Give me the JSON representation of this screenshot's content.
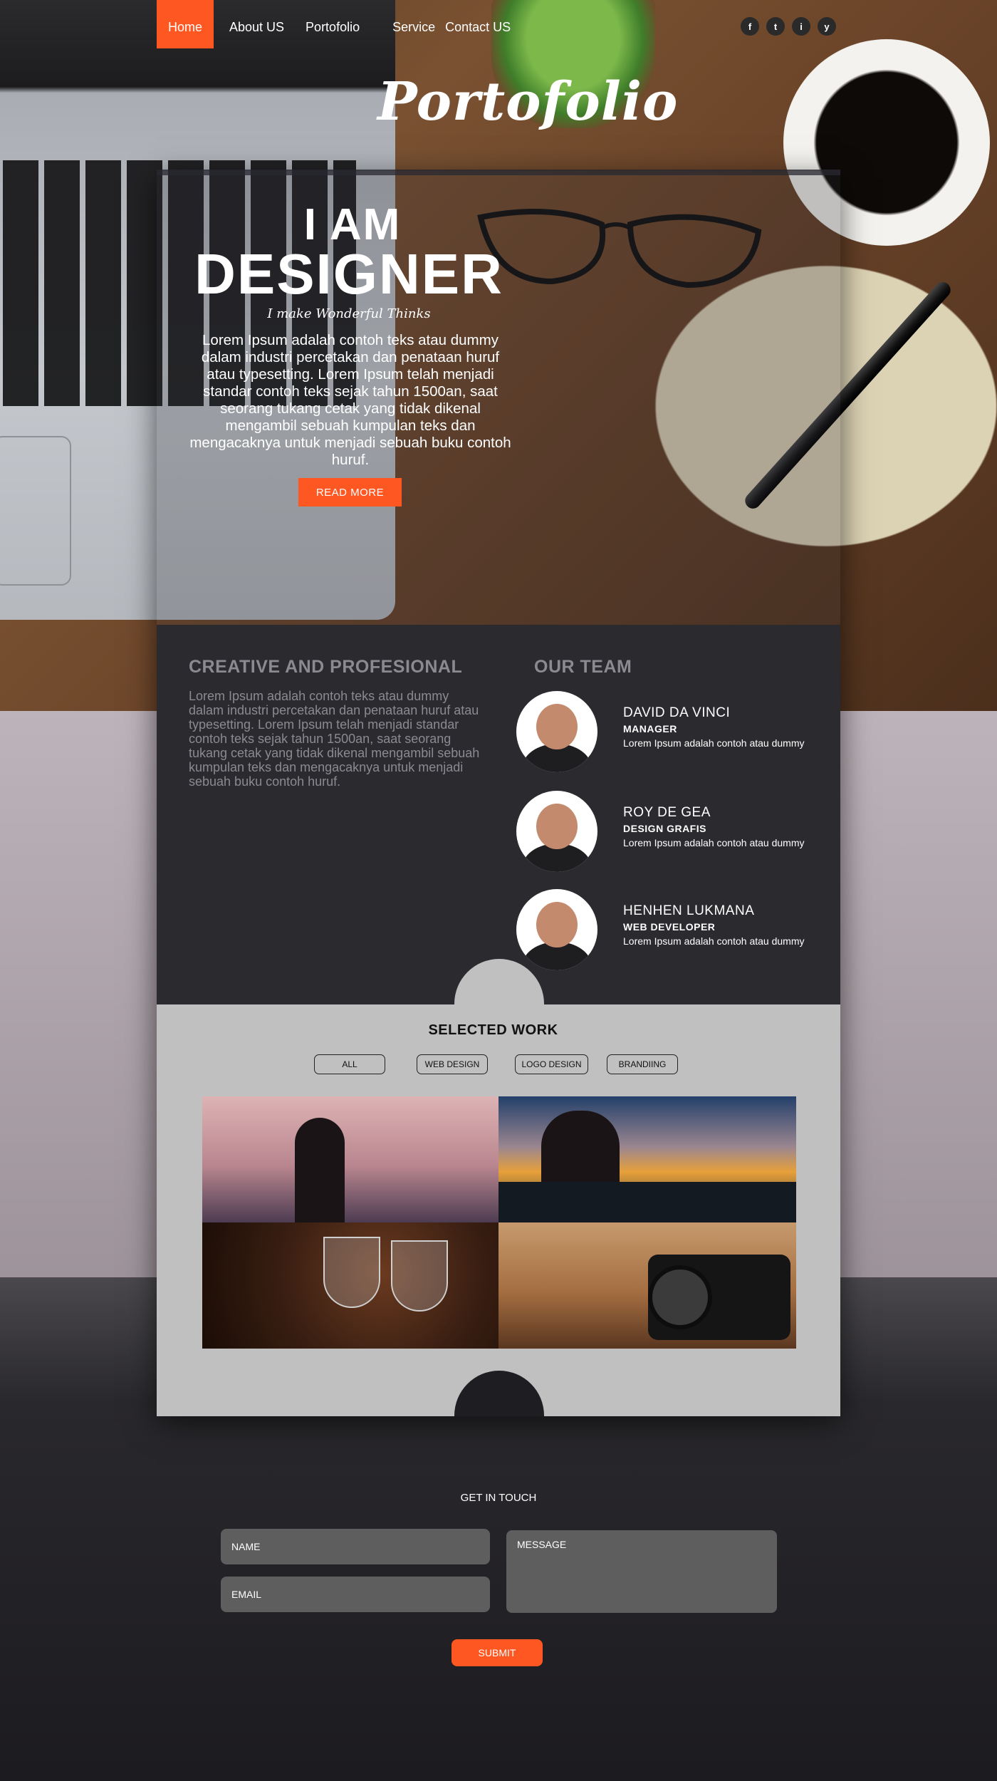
{
  "nav": {
    "items": [
      "Home",
      "About US",
      "Portofolio",
      "Service",
      "Contact US"
    ],
    "active": "Home"
  },
  "social": [
    "f",
    "t",
    "i",
    "y"
  ],
  "logo": "Portofolio",
  "hero": {
    "line1": "I AM",
    "line2": "DESIGNER",
    "tagline": "I make Wonderful Thinks",
    "text": "Lorem Ipsum adalah contoh teks atau dummy dalam industri percetakan dan penataan huruf atau typesetting. Lorem Ipsum telah menjadi standar contoh teks sejak tahun 1500an, saat seorang tukang cetak yang tidak dikenal mengambil sebuah kumpulan teks dan mengacaknya untuk menjadi sebuah buku contoh huruf.",
    "button": "READ MORE"
  },
  "about": {
    "title": "CREATIVE AND PROFESIONAL",
    "text": "Lorem Ipsum adalah contoh teks atau dummy dalam industri percetakan dan penataan huruf atau typesetting. Lorem Ipsum telah menjadi standar contoh teks sejak tahun 1500an, saat seorang tukang cetak yang tidak dikenal mengambil sebuah kumpulan teks dan mengacaknya untuk menjadi sebuah buku contoh huruf."
  },
  "team": {
    "title": "OUR TEAM",
    "members": [
      {
        "name": "DAVID DA VINCI",
        "role": "MANAGER",
        "desc": "Lorem Ipsum adalah  contoh atau dummy"
      },
      {
        "name": "ROY DE GEA",
        "role": "DESIGN GRAFIS",
        "desc": "Lorem Ipsum adalah  contoh atau dummy"
      },
      {
        "name": "HENHEN LUKMANA",
        "role": "WEB DEVELOPER",
        "desc": "Lorem Ipsum adalah  contoh atau dummy"
      }
    ]
  },
  "work": {
    "title": "SELECTED WORK",
    "filters": [
      "ALL",
      "WEB DESIGN",
      "LOGO DESIGN",
      "BRANDIING"
    ]
  },
  "contact": {
    "title": "GET IN TOUCH",
    "name_placeholder": "NAME",
    "email_placeholder": "EMAIL",
    "message_placeholder": "MESSAGE",
    "submit": "SUBMIT"
  },
  "colors": {
    "accent": "#ff5722",
    "dark_section": "#2a2a2f",
    "light_section": "#c0c0c0"
  }
}
